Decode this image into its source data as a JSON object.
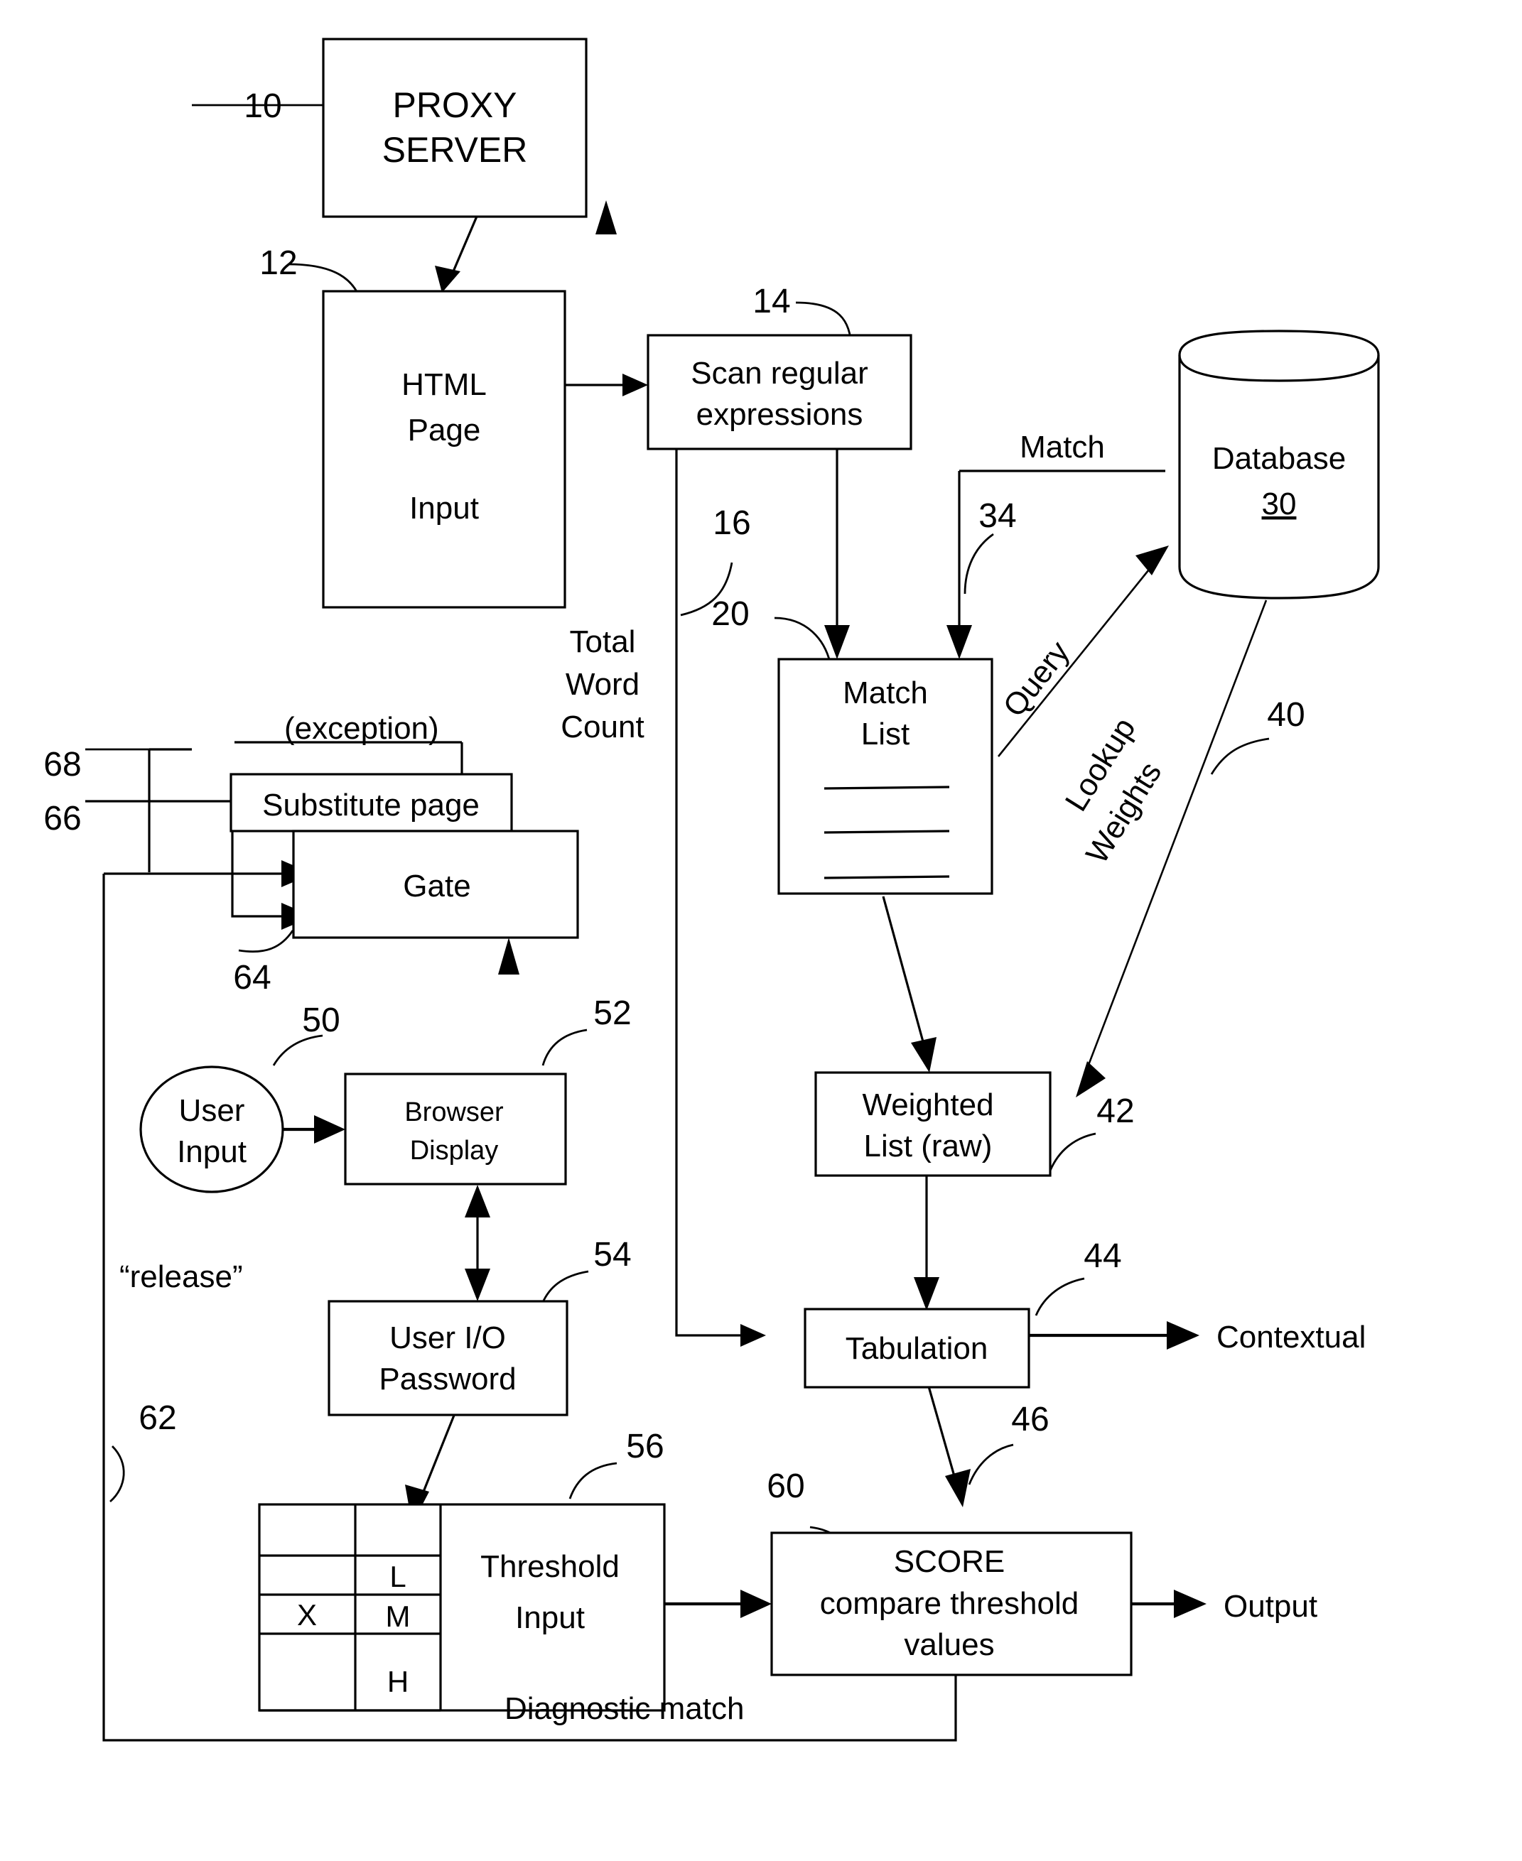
{
  "figure": {
    "kind": "patent-flow-diagram",
    "background": "#ffffff",
    "ink": "#000000"
  },
  "nodes": {
    "proxy_server": {
      "line1": "PROXY",
      "line2": "SERVER",
      "ref": "10"
    },
    "html_page": {
      "line1": "HTML",
      "line2": "Page",
      "line3": "Input",
      "ref": "12"
    },
    "scan_regex": {
      "line1": "Scan regular",
      "line2": "expressions",
      "ref": "14"
    },
    "database": {
      "label": "Database",
      "ref_inline": "30"
    },
    "match_list": {
      "line1": "Match",
      "line2": "List",
      "ref": "20"
    },
    "weighted_list": {
      "line1": "Weighted",
      "line2": "List (raw)",
      "ref": "42"
    },
    "tabulation": {
      "label": "Tabulation",
      "ref": "44"
    },
    "score": {
      "line1": "SCORE",
      "line2": "compare threshold",
      "line3": "values",
      "ref": "60"
    },
    "substitute_page": {
      "label": "Substitute page",
      "ref": "66"
    },
    "gate": {
      "label": "Gate",
      "ref": "64"
    },
    "user_input": {
      "line1": "User",
      "line2": "Input",
      "ref": "50"
    },
    "browser_display": {
      "line1": "Browser",
      "line2": "Display",
      "ref": "52"
    },
    "user_io": {
      "line1": "User I/O",
      "line2": "Password",
      "ref": "54"
    },
    "threshold_input": {
      "line1": "Threshold",
      "line2": "Input",
      "ref": "56"
    }
  },
  "threshold_table": {
    "rows": [
      {
        "mark": "",
        "level": ""
      },
      {
        "mark": "",
        "level": "L"
      },
      {
        "mark": "X",
        "level": "M"
      },
      {
        "mark": "",
        "level": "H"
      }
    ]
  },
  "edge_labels": {
    "total_word_count": {
      "line1": "Total",
      "line2": "Word",
      "line3": "Count",
      "ref": "16"
    },
    "match": "Match",
    "match_ref": "34",
    "query": "Query",
    "lookup_weights": {
      "line1": "Lookup",
      "line2": "Weights",
      "ref": "40"
    },
    "contextual": "Contextual",
    "output": "Output",
    "diagnostic_match": "Diagnostic match",
    "release": "“release”",
    "release_ref": "62",
    "exception": "(exception)",
    "exception_ref": "68",
    "score_ref": "46"
  }
}
